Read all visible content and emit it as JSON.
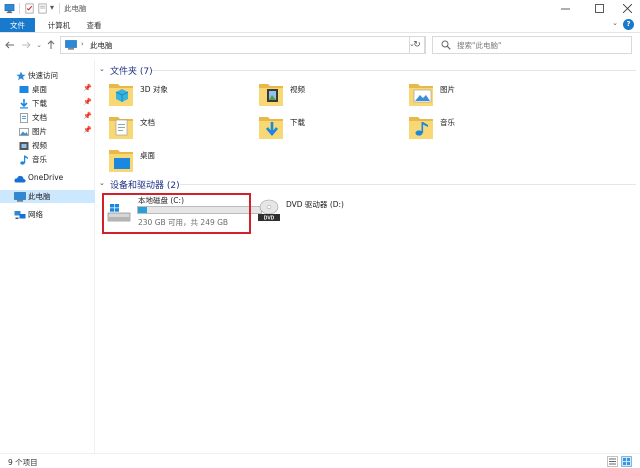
{
  "window": {
    "title": "此电脑",
    "controls": [
      "minimize-icon",
      "maximize-icon",
      "close-icon"
    ]
  },
  "ribbon": {
    "tabs": [
      {
        "label": "文件",
        "active": true
      },
      {
        "label": "计算机",
        "active": false
      },
      {
        "label": "查看",
        "active": false
      }
    ]
  },
  "address": {
    "path": "此电脑",
    "search_placeholder": "搜索\"此电脑\""
  },
  "sidebar": {
    "quick_access": "快速访问",
    "items": [
      {
        "label": "桌面",
        "icon": "desktop-icon",
        "pinned": true
      },
      {
        "label": "下载",
        "icon": "download-icon",
        "pinned": true
      },
      {
        "label": "文档",
        "icon": "documents-icon",
        "pinned": true
      },
      {
        "label": "图片",
        "icon": "pictures-icon",
        "pinned": true
      },
      {
        "label": "视频",
        "icon": "videos-icon",
        "pinned": false
      },
      {
        "label": "音乐",
        "icon": "music-icon",
        "pinned": false
      }
    ],
    "onedrive": "OneDrive",
    "this_pc": "此电脑",
    "network": "网络"
  },
  "folders_group": {
    "title": "文件夹 (7)",
    "items": [
      {
        "label": "3D 对象",
        "icon": "3d-objects-icon"
      },
      {
        "label": "视频",
        "icon": "videos-icon"
      },
      {
        "label": "图片",
        "icon": "pictures-icon"
      },
      {
        "label": "文档",
        "icon": "documents-icon"
      },
      {
        "label": "下载",
        "icon": "download-icon"
      },
      {
        "label": "音乐",
        "icon": "music-icon"
      },
      {
        "label": "桌面",
        "icon": "desktop-icon"
      }
    ]
  },
  "drives_group": {
    "title": "设备和驱动器 (2)",
    "items": [
      {
        "label": "本地磁盘 (C:)",
        "free": "230 GB 可用，共 249 GB",
        "used_fraction": 0.076
      },
      {
        "label": "DVD 驱动器 (D:)"
      }
    ]
  },
  "status": {
    "count": "9 个项目"
  },
  "colors": {
    "accent": "#1979ca",
    "selection": "#cce8ff",
    "group_title": "#1e3287",
    "drive_fill": "#26a0da",
    "highlight_box": "#d1212b"
  }
}
